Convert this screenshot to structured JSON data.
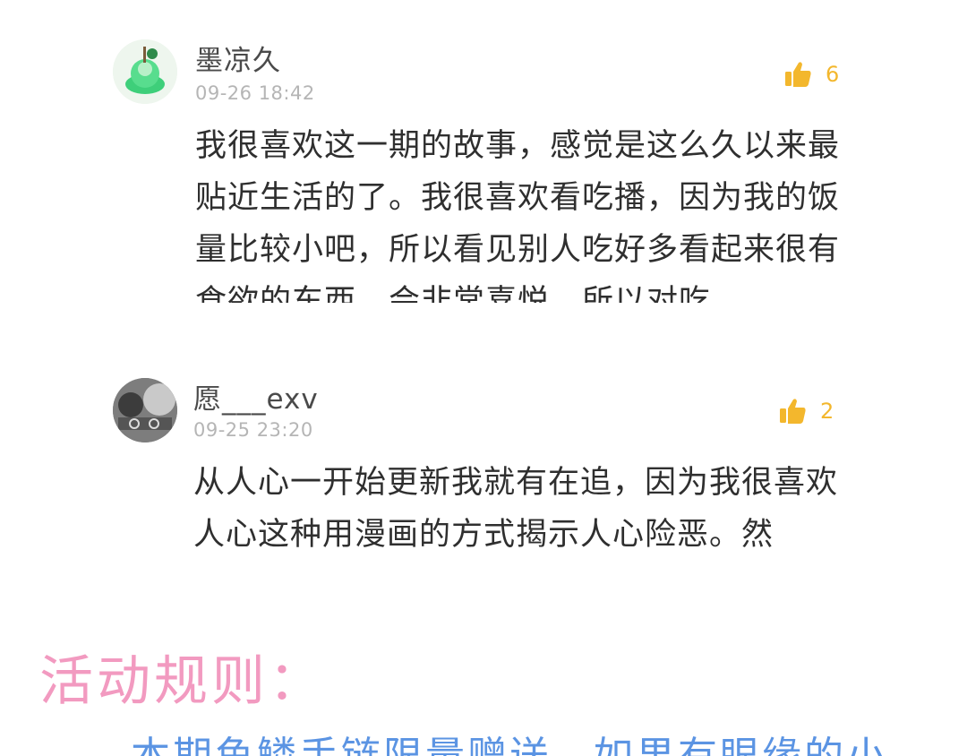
{
  "comments": [
    {
      "username": "墨凉久",
      "timestamp": "09-26 18:42",
      "likes": "6",
      "body": "我很喜欢这一期的故事，感觉是这么久以来最贴近生活的了。我很喜欢看吃播，因为我的饭量比较小吧，所以看见别人吃好多看起来很有食欲的东西，会非常喜悦，所以对吃"
    },
    {
      "username": "愿___exv",
      "timestamp": "09-25 23:20",
      "likes": "2",
      "body": "从人心一开始更新我就有在追，因为我很喜欢人心这种用漫画的方式揭示人心险恶。然"
    }
  ],
  "rules": {
    "heading": "活动规则：",
    "line": "本期鱼鳞手链限量赠送，如果有眼缘的小"
  },
  "colors": {
    "like": "#f3b72d",
    "heading": "#f29ac0",
    "rules_text": "#5b94e3"
  }
}
